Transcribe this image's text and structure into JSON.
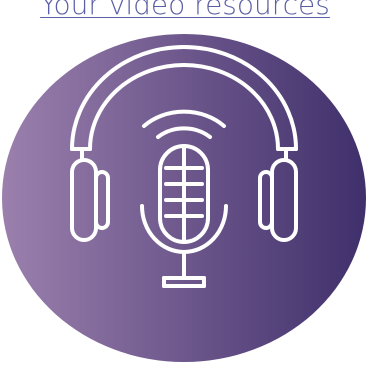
{
  "link": {
    "text": "Your video resources"
  },
  "badge": {
    "icon": "podcast-headphones-microphone-icon",
    "gradient_start": "#9b80ad",
    "gradient_end": "#3f2f6b",
    "line_color": "#ffffff"
  }
}
